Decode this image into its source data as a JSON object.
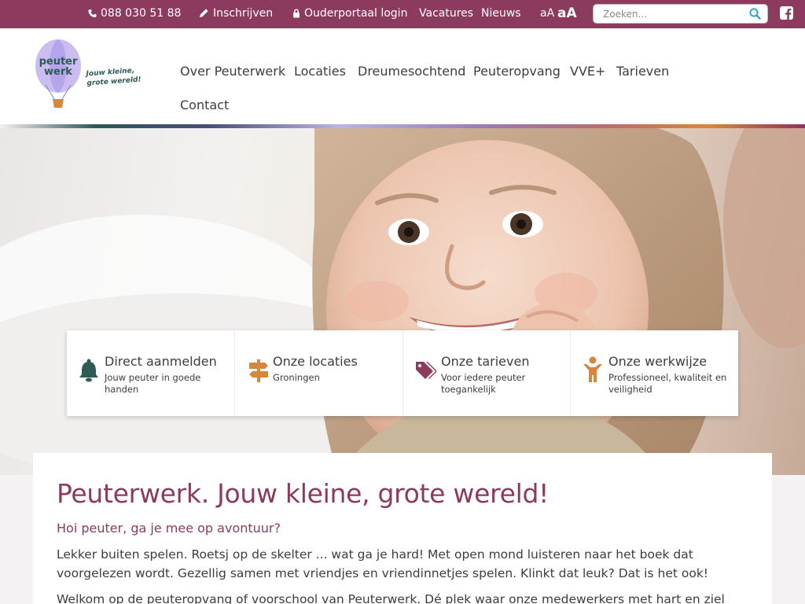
{
  "topbar": {
    "phone": "088 030 51 88",
    "signup": "Inschrijven",
    "parent_login": "Ouderportaal login",
    "vacancies": "Vacatures",
    "news": "Nieuws",
    "font_small": "aA",
    "font_large": "aA",
    "search_placeholder": "Zoeken...",
    "background_color": "#8c3a5d"
  },
  "logo": {
    "word1": "peuter",
    "word2": "werk",
    "tagline_line1": "Jouw kleine,",
    "tagline_line2": "grote wereld!"
  },
  "nav": {
    "items": [
      "Over Peuterwerk",
      "Locaties",
      "Dreumesochtend",
      "Peuteropvang",
      "VVE+",
      "Tarieven",
      "Contact"
    ]
  },
  "cards": [
    {
      "title": "Direct aanmelden",
      "subtitle": "Jouw peuter in goede handen",
      "icon": "bell-icon",
      "color": "#2e5b57"
    },
    {
      "title": "Onze locaties",
      "subtitle": "Groningen",
      "icon": "signpost-icon",
      "color": "#d7873b"
    },
    {
      "title": "Onze tarieven",
      "subtitle": "Voor iedere peuter toegankelijk",
      "icon": "price-tags-icon",
      "color": "#8c3a5d"
    },
    {
      "title": "Onze werkwijze",
      "subtitle": "Professioneel, kwaliteit en veiligheid",
      "icon": "child-icon",
      "color": "#d7873b"
    }
  ],
  "content": {
    "heading": "Peuterwerk. Jouw kleine, grote wereld!",
    "subheading": "Hoi peuter, ga je mee op avontuur?",
    "paragraph1": "Lekker buiten spelen. Roetsj op de skelter ... wat ga je hard! Met open mond luisteren naar het boek dat voorgelezen wordt. Gezellig samen met vriendjes en vriendinnetjes spelen. Klinkt dat leuk? Dat is het ook!",
    "paragraph2": "Welkom op de peuteropvang of voorschool van Peuterwerk. Dé plek waar onze medewerkers met hart en ziel"
  },
  "colors": {
    "brand": "#8c3a5d",
    "green": "#2e5b57",
    "orange": "#d7873b"
  }
}
